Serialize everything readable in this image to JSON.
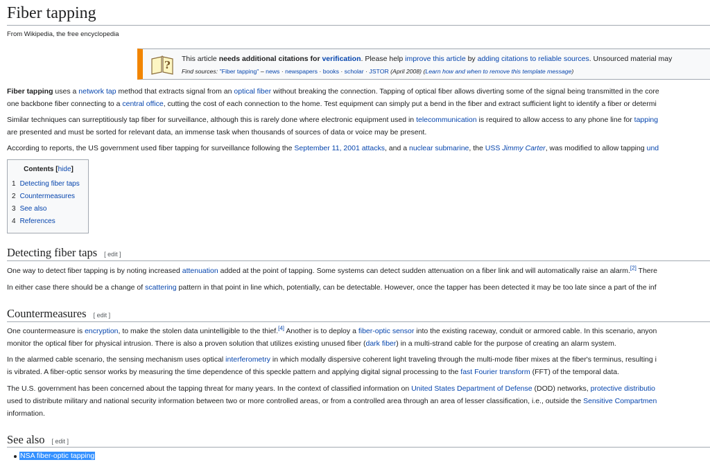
{
  "article": {
    "title": "Fiber tapping",
    "tagline": "From Wikipedia, the free encyclopedia"
  },
  "ambox": {
    "icon": "book-question-icon",
    "m1": "This article ",
    "m2": "needs additional citations for ",
    "m3": "verification",
    "m4": ". Please help ",
    "m5": "improve this article",
    "m6": " by ",
    "m7": "adding citations to reliable sources",
    "m8": ". Unsourced material may",
    "find_label": "Find sources: ",
    "f1": "\"Fiber tapping\"",
    "f2": " – ",
    "f3": "news",
    "f4": " · ",
    "f5": "newspapers",
    "f6": " · ",
    "f7": "books",
    "f8": " · ",
    "f9": "scholar",
    "f10": " · ",
    "f11": "JSTOR",
    "f12": " (April 2008) (",
    "f13": "Learn how and when to remove this template message",
    "f14": ")"
  },
  "intro": {
    "p1a_b": "Fiber tapping",
    "p1a_1": " uses a ",
    "p1a_2": "network tap",
    "p1a_3": " method that extracts signal from an ",
    "p1a_4": "optical fiber",
    "p1a_5": " without breaking the connection. Tapping of optical fiber allows diverting some of the signal being transmitted in the core",
    "p1b_1": "one backbone fiber connecting to a ",
    "p1b_2": "central office",
    "p1b_3": ", cutting the cost of each connection to the home. Test equipment can simply put a bend in the fiber and extract sufficient light to identify a fiber or determi",
    "p2a_1": "Similar techniques can surreptitiously tap fiber for surveillance, although this is rarely done where electronic equipment used in ",
    "p2a_2": "telecommunication",
    "p2a_3": " is required to allow access to any phone line for ",
    "p2a_4": "tapping",
    "p2b": "are presented and must be sorted for relevant data, an immense task when thousands of sources of data or voice may be present.",
    "p3_1": "According to reports, the US government used fiber tapping for surveillance following the ",
    "p3_2": "September 11, 2001 attacks",
    "p3_3": ", and a ",
    "p3_4": "nuclear submarine",
    "p3_5": ", the ",
    "p3_6": "USS ",
    "p3_7": "Jimmy Carter",
    "p3_8": ", was modified to allow tapping ",
    "p3_9": "und"
  },
  "toc": {
    "title": "Contents",
    "hide_open": " [",
    "hide": "hide",
    "hide_close": "]",
    "items": [
      {
        "num": "1",
        "label": "Detecting fiber taps"
      },
      {
        "num": "2",
        "label": "Countermeasures"
      },
      {
        "num": "3",
        "label": "See also"
      },
      {
        "num": "4",
        "label": "References"
      }
    ]
  },
  "detecting": {
    "heading": "Detecting fiber taps",
    "edit": "[ edit ]",
    "p1_1": "One way to detect fiber tapping is by noting increased ",
    "p1_2": "attenuation",
    "p1_3": " added at the point of tapping. Some systems can detect sudden attenuation on a fiber link and will automatically raise an alarm.",
    "p1_ref": "[2]",
    "p1_4": " There",
    "p2_1": "In either case there should be a change of ",
    "p2_2": "scattering",
    "p2_3": " pattern in that point in line which, potentially, can be detectable. However, once the tapper has been detected it may be too late since a part of the inf"
  },
  "counter": {
    "heading": "Countermeasures",
    "edit": "[ edit ]",
    "p1a_1": "One countermeasure is ",
    "p1a_2": "encryption",
    "p1a_3": ", to make the stolen data unintelligible to the thief.",
    "p1a_ref": "[4]",
    "p1a_4": " Another is to deploy a ",
    "p1a_5": "fiber-optic sensor",
    "p1a_6": " into the existing raceway, conduit or armored cable. In this scenario, anyon",
    "p1b_1": "monitor the optical fiber for physical intrusion. There is also a proven solution that utilizes existing unused fiber (",
    "p1b_2": "dark fiber",
    "p1b_3": ") in a multi-strand cable for the purpose of creating an alarm system.",
    "p2a_1": "In the alarmed cable scenario, the sensing mechanism uses optical ",
    "p2a_2": "interferometry",
    "p2a_3": " in which modally dispersive coherent light traveling through the multi-mode fiber mixes at the fiber's terminus, resulting i",
    "p2b_1": "is vibrated. A fiber-optic sensor works by measuring the time dependence of this speckle pattern and applying digital signal processing to the ",
    "p2b_2": "fast Fourier transform",
    "p2b_3": " (FFT) of the temporal data.",
    "p3a_1": "The U.S. government has been concerned about the tapping threat for many years. In the context of classified information on ",
    "p3a_2": "United States Department of Defense",
    "p3a_3": " (DOD) networks, ",
    "p3a_4": "protective distributio",
    "p3b_1": "used to distribute military and national security information between two or more controlled areas, or from a controlled area through an area of lesser classification, i.e., outside the ",
    "p3b_2": "Sensitive Compartmen",
    "p3c": "information."
  },
  "seealso": {
    "heading": "See also",
    "edit": "[ edit ]",
    "items": [
      "NSA fiber-optic tapping"
    ]
  }
}
